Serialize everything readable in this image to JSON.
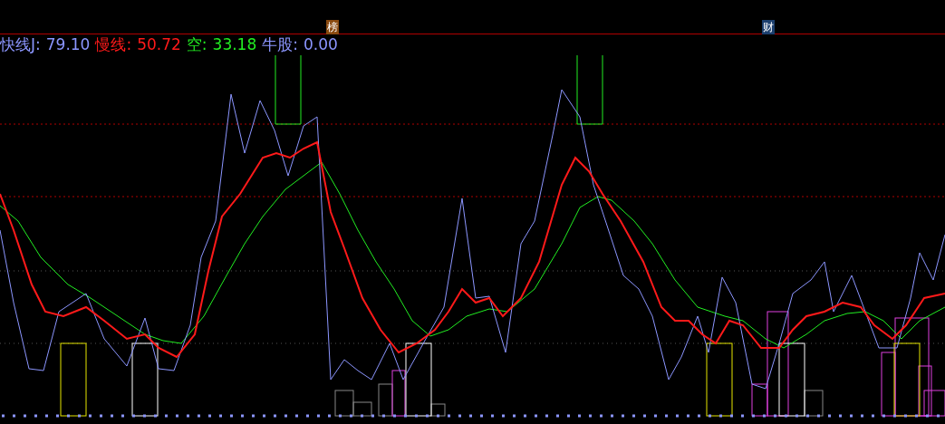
{
  "markers": [
    {
      "text": "榜",
      "color": "#8a4a10"
    },
    {
      "text": "财",
      "color": "#1c3f6e"
    }
  ],
  "legend": [
    {
      "label": "快线J:",
      "value": "79.10",
      "color": "#8c96ff"
    },
    {
      "label": "慢线:",
      "value": "50.72",
      "color": "#ff1a1a"
    },
    {
      "label": "空:",
      "value": "33.18",
      "color": "#22ee22"
    },
    {
      "label": "牛股:",
      "value": "0.00",
      "color": "#8c96ff"
    }
  ]
}
